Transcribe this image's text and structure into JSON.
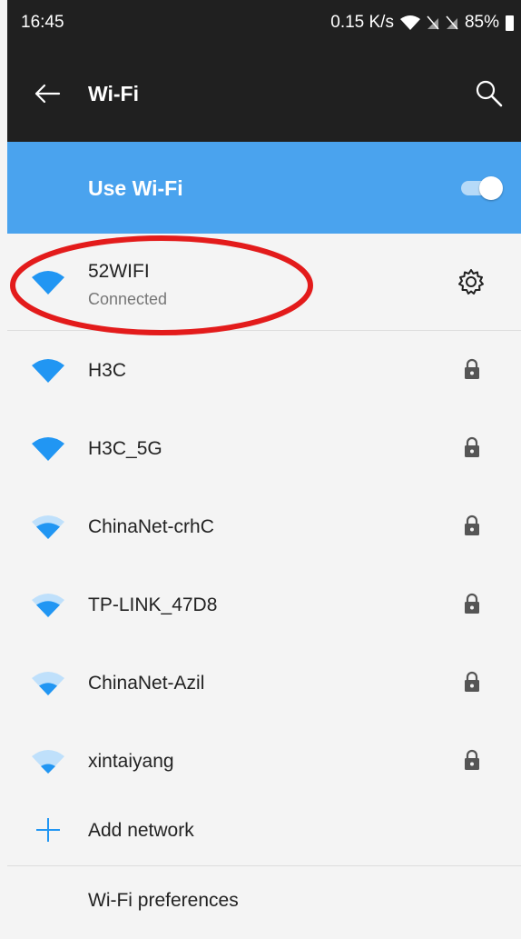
{
  "status_bar": {
    "time": "16:45",
    "speed": "0.15 K/s",
    "battery": "85%"
  },
  "app_bar": {
    "title": "Wi-Fi"
  },
  "wifi_toggle": {
    "label": "Use Wi-Fi",
    "enabled": true
  },
  "connected_network": {
    "name": "52WIFI",
    "status": "Connected"
  },
  "networks": [
    {
      "name": "H3C",
      "signal": "full"
    },
    {
      "name": "H3C_5G",
      "signal": "full"
    },
    {
      "name": "ChinaNet-crhC",
      "signal": "medium"
    },
    {
      "name": "TP-LINK_47D8",
      "signal": "medium"
    },
    {
      "name": "ChinaNet-Azil",
      "signal": "low"
    },
    {
      "name": "xintaiyang",
      "signal": "low"
    }
  ],
  "add_network": {
    "label": "Add network"
  },
  "preferences": {
    "label": "Wi-Fi preferences"
  },
  "colors": {
    "accent": "#4aa3ee",
    "wifi_full": "#2196f3",
    "wifi_faint": "#bfe0fb",
    "annotation": "#e31b1b"
  }
}
